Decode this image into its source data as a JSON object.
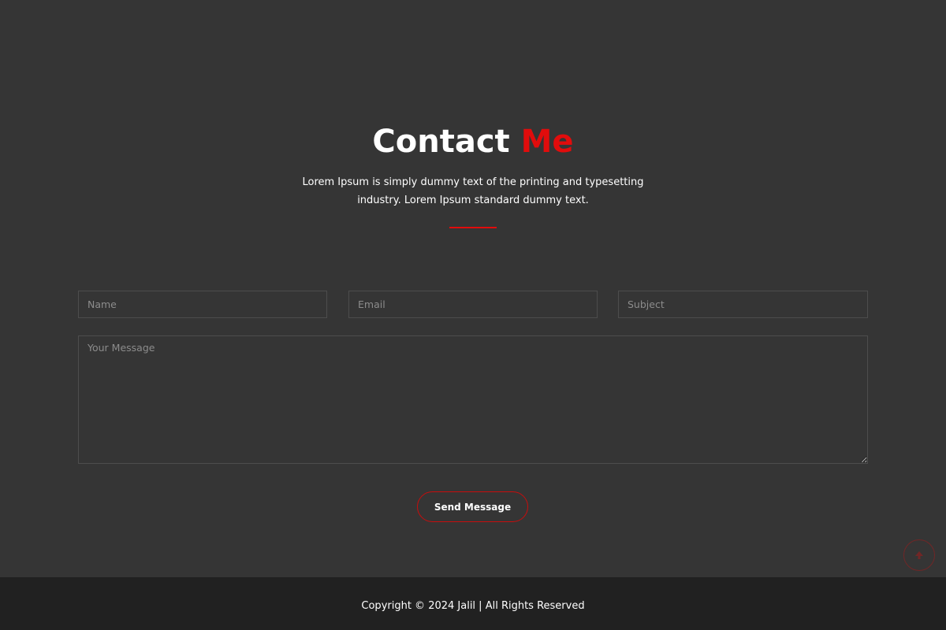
{
  "contact": {
    "title_main": "Contact",
    "title_accent": "Me",
    "description": "Lorem Ipsum is simply dummy text of the printing and typesetting industry. Lorem Ipsum standard dummy text."
  },
  "form": {
    "name_placeholder": "Name",
    "email_placeholder": "Email",
    "subject_placeholder": "Subject",
    "message_placeholder": "Your Message",
    "submit_label": "Send Message"
  },
  "footer": {
    "copyright": "Copyright © 2024 Jalil | All Rights Reserved"
  },
  "icons": {
    "scroll_top": "arrow-up-icon"
  },
  "colors": {
    "background": "#353535",
    "footer_background": "#212121",
    "accent": "#e10c0c",
    "text": "#ffffff"
  }
}
